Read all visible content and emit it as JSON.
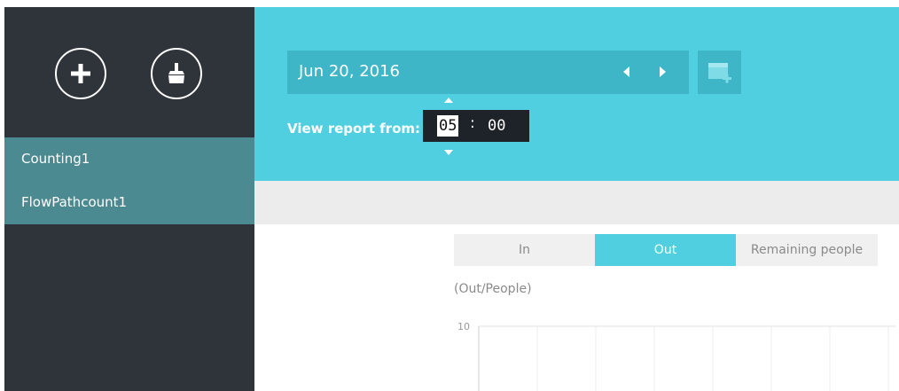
{
  "sidebar": {
    "add_icon": "plus-icon",
    "clear_icon": "broom-icon",
    "items": [
      {
        "label": "Counting1"
      },
      {
        "label": "FlowPathcount1"
      }
    ]
  },
  "header": {
    "date": "Jun 20, 2016",
    "view_label": "View report from:",
    "hour": "05",
    "separator": ":",
    "minute": "00"
  },
  "tabs": [
    {
      "label": "In"
    },
    {
      "label": "Out"
    },
    {
      "label": "Remaining people"
    }
  ],
  "active_tab": "Out",
  "chart": {
    "ylabel": "(Out/People)",
    "ytick_top": "10"
  },
  "colors": {
    "sidebar": "#2f333a",
    "list_bg": "#4c8a91",
    "header": "#50cfe0",
    "date_bar": "#3fb6c7",
    "active_tab": "#50cfe0"
  }
}
